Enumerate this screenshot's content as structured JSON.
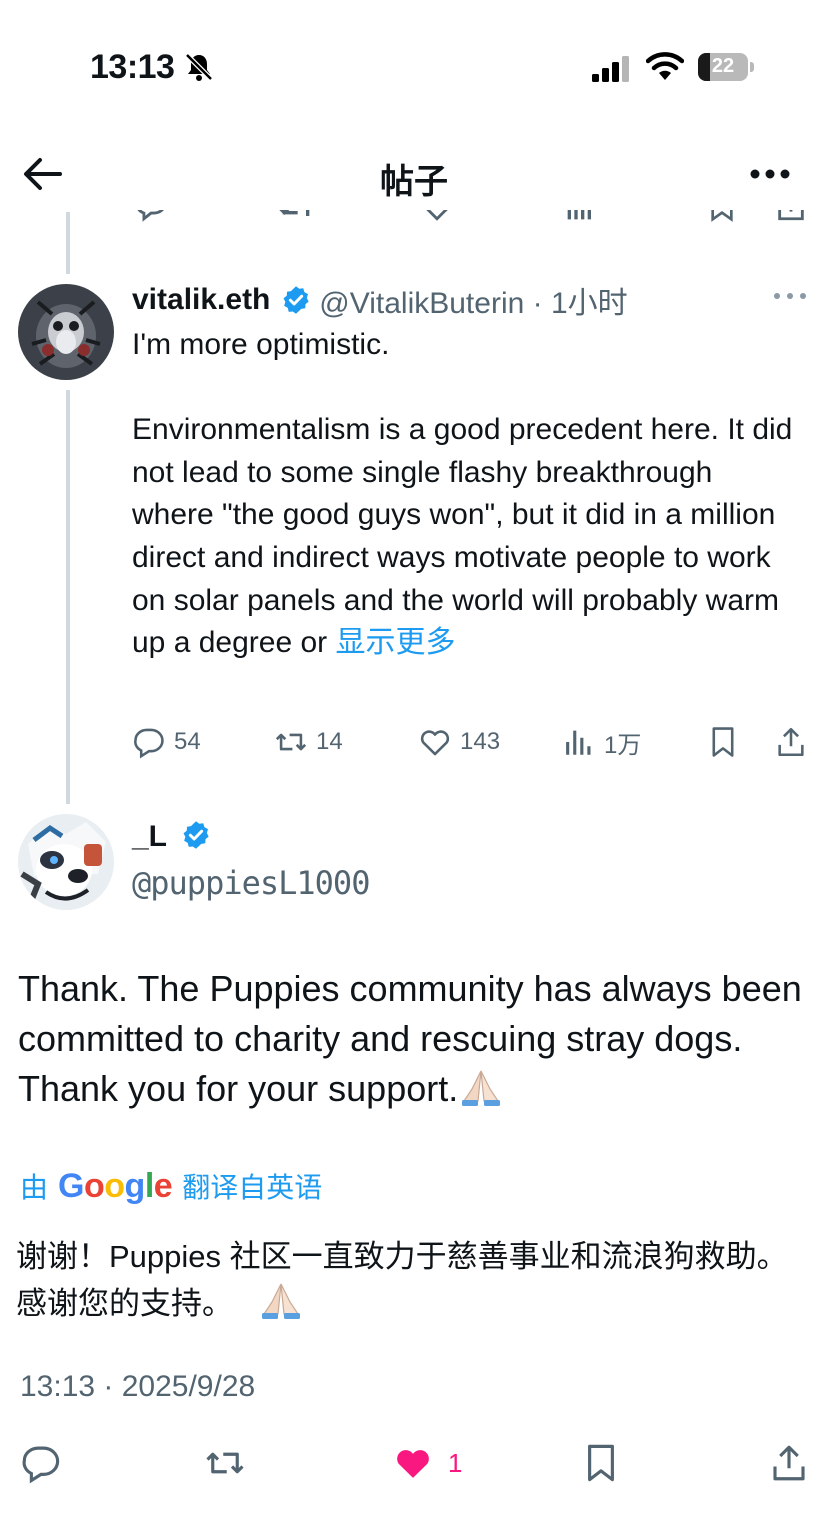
{
  "status_bar": {
    "time": "13:13",
    "battery": "22"
  },
  "nav": {
    "title": "帖子"
  },
  "reply": {
    "name": "vitalik.eth",
    "handle_time": "@VitalikButerin · 1小时",
    "line1": "I'm more optimistic.",
    "body": "Environmentalism is a good precedent here. It did not lead to some single flashy breakthrough where \"the good guys won\", but it did in a million direct and indirect ways motivate people to work on solar panels and the world will probably warm up a degree or",
    "show_more": "显示更多",
    "actions": {
      "replies": "54",
      "reposts": "14",
      "likes": "143",
      "views": "1万"
    }
  },
  "main": {
    "name": "_L",
    "handle": "@puppiesL1000",
    "text": "Thank. The Puppies community has always been committed to charity and rescuing stray dogs. Thank you for your support.",
    "translate_prefix": "由",
    "translate_brand": "Google",
    "translate_suffix": "翻译自英语",
    "translated": "谢谢！Puppies 社区一直致力于慈善事业和流浪狗救助。感谢您的支持。",
    "timestamp": "13:13 · 2025/9/28",
    "like_count": "1"
  },
  "colors": {
    "accent": "#1d9bf0",
    "like": "#f91880",
    "muted": "#536471",
    "verified": "#1d9bf0"
  },
  "icons": [
    "bell-slash-icon",
    "signal-icon",
    "wifi-icon",
    "back-arrow-icon",
    "more-icon",
    "verified-icon",
    "reply-icon",
    "repost-icon",
    "like-icon",
    "views-icon",
    "bookmark-icon",
    "share-icon",
    "folded-hands-emoji"
  ]
}
